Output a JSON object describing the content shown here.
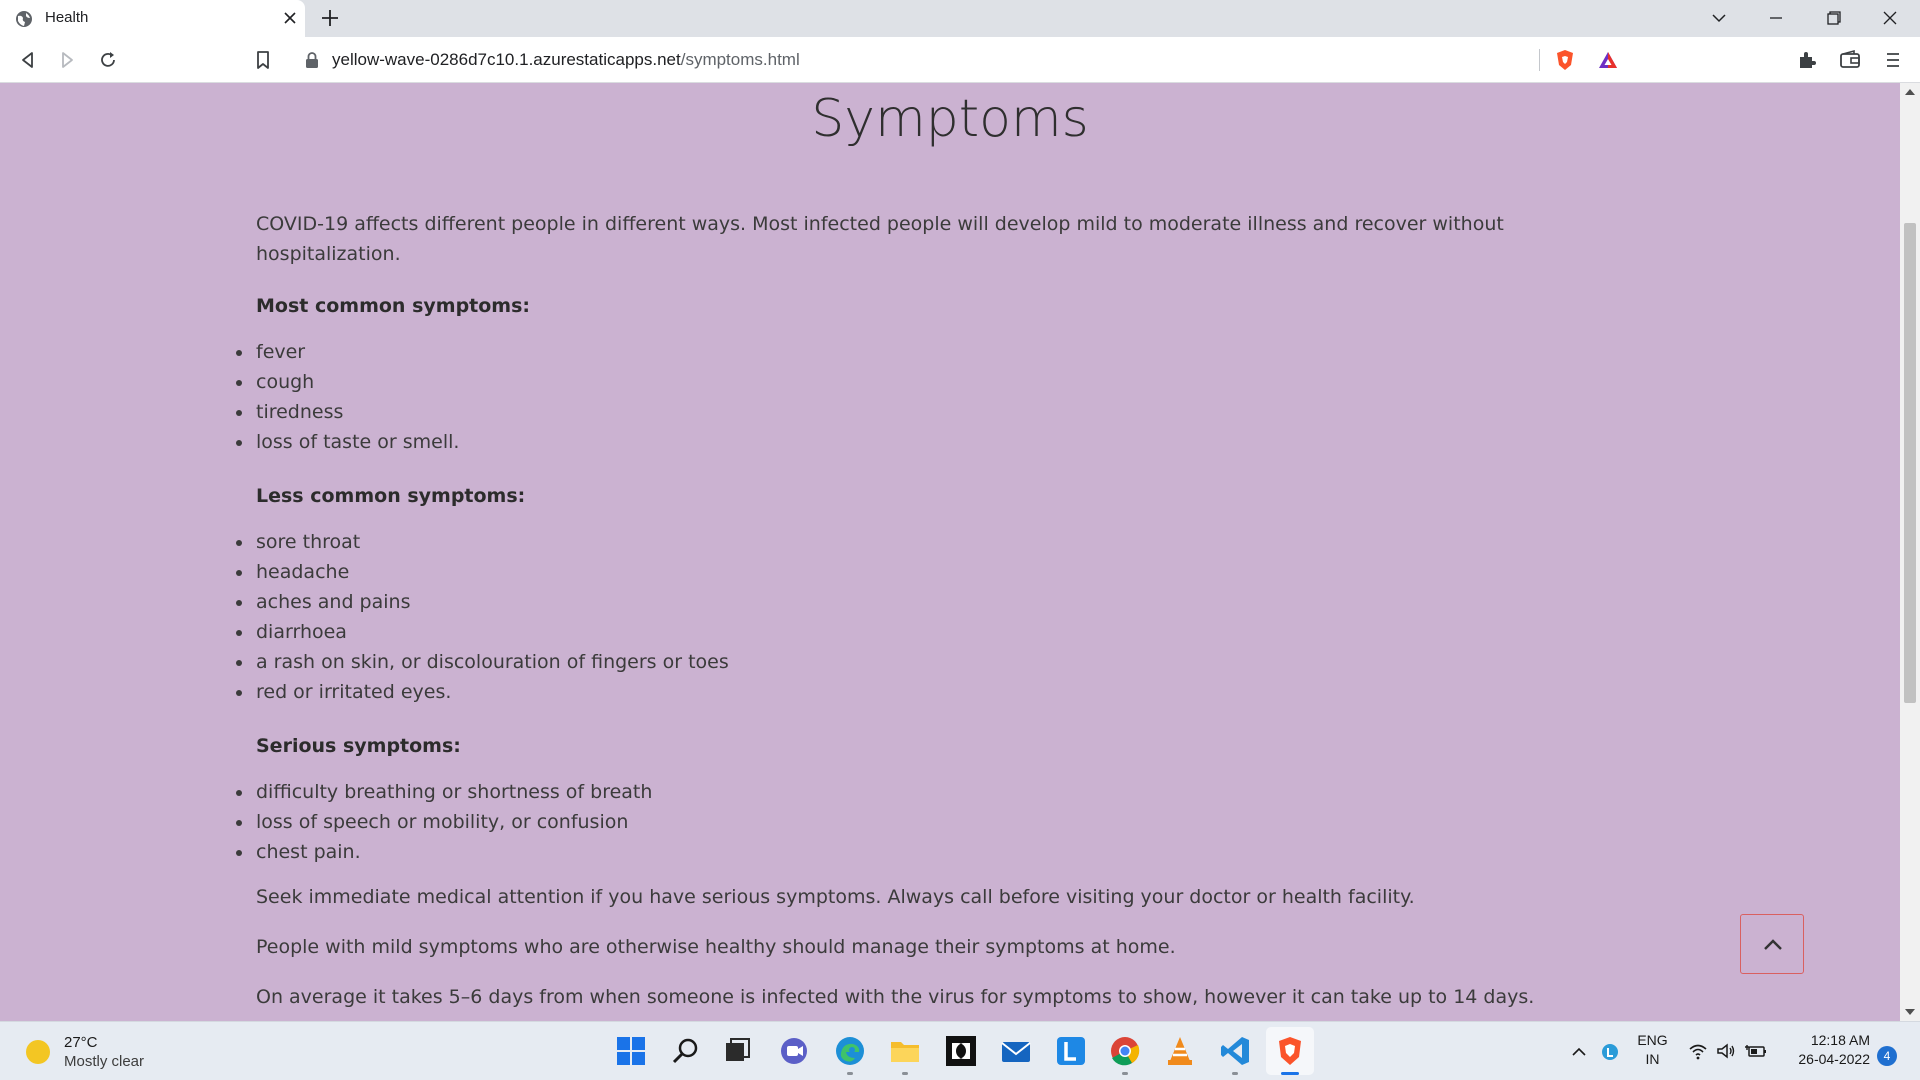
{
  "browser": {
    "tab_title": "Health",
    "url_domain": "yellow-wave-0286d7c10.1.azurestaticapps.net",
    "url_path": "/symptoms.html"
  },
  "page": {
    "title": "Symptoms",
    "intro": "COVID-19 affects different people in different ways. Most infected people will develop mild to moderate illness and recover without hospitalization.",
    "common_heading": "Most common symptoms:",
    "common": [
      "fever",
      "cough",
      "tiredness",
      "loss of taste or smell."
    ],
    "less_heading": "Less common symptoms:",
    "less": [
      "sore throat",
      "headache",
      "aches and pains",
      "diarrhoea",
      "a rash on skin, or discolouration of fingers or toes",
      "red or irritated eyes."
    ],
    "serious_heading": "Serious symptoms:",
    "serious": [
      "difficulty breathing or shortness of breath",
      "loss of speech or mobility, or confusion",
      "chest pain."
    ],
    "advice_1": "Seek immediate medical attention if you have serious symptoms. Always call before visiting your doctor or health facility.",
    "advice_2": "People with mild symptoms who are otherwise healthy should manage their symptoms at home.",
    "advice_3": "On average it takes 5–6 days from when someone is infected with the virus for symptoms to show, however it can take up to 14 days.",
    "colors": {
      "background": "#cbb2d1",
      "back_to_top_border": "#d96060"
    }
  },
  "taskbar": {
    "weather_temp": "27°C",
    "weather_condition": "Mostly clear",
    "language_top": "ENG",
    "language_bottom": "IN",
    "time": "12:18 AM",
    "date": "26-04-2022",
    "notification_count": "4",
    "apps": [
      "start-icon",
      "search-icon",
      "task-view-icon",
      "teams-chat-icon",
      "edge-icon",
      "file-explorer-icon",
      "dolby-icon",
      "mail-icon",
      "l-app-icon",
      "chrome-icon",
      "vlc-icon",
      "vscode-icon",
      "brave-icon"
    ]
  }
}
